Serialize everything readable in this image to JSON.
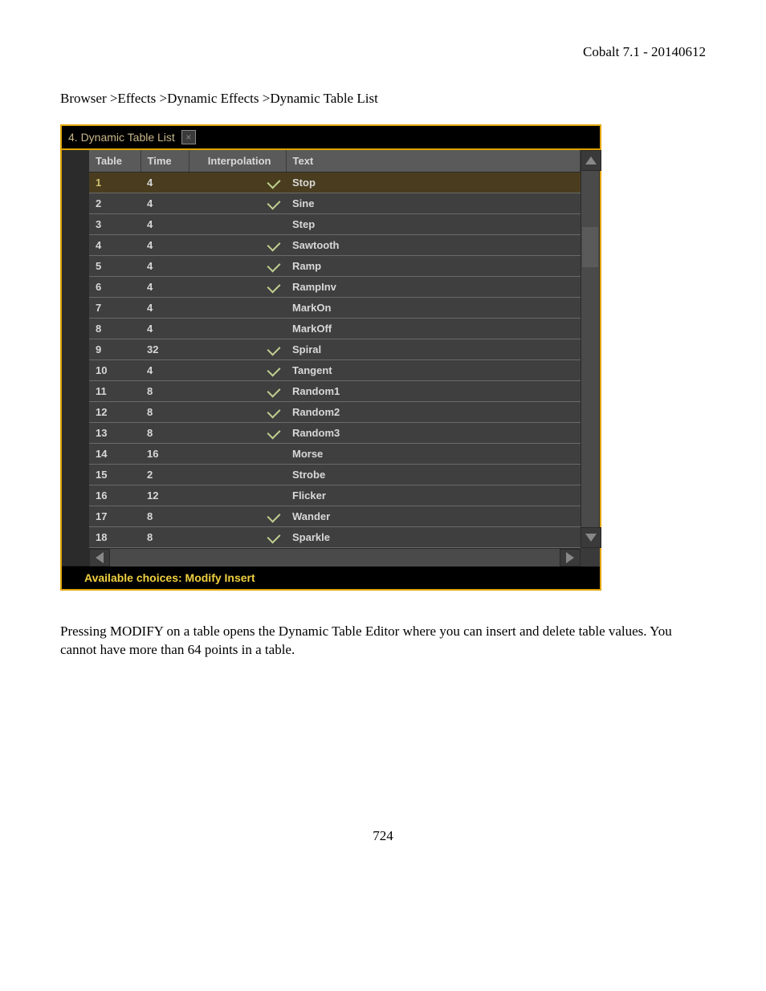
{
  "header": {
    "product_version": "Cobalt 7.1 - 20140612"
  },
  "breadcrumb": "Browser >Effects >Dynamic Effects >Dynamic Table List",
  "panel": {
    "title": "4. Dynamic Table List",
    "columns": {
      "table": "Table",
      "time": "Time",
      "interpolation": "Interpolation",
      "text": "Text"
    },
    "rows": [
      {
        "table": "1",
        "time": "4",
        "interp": true,
        "text": "Stop",
        "selected": true
      },
      {
        "table": "2",
        "time": "4",
        "interp": true,
        "text": "Sine",
        "selected": false
      },
      {
        "table": "3",
        "time": "4",
        "interp": false,
        "text": "Step",
        "selected": false
      },
      {
        "table": "4",
        "time": "4",
        "interp": true,
        "text": "Sawtooth",
        "selected": false
      },
      {
        "table": "5",
        "time": "4",
        "interp": true,
        "text": "Ramp",
        "selected": false
      },
      {
        "table": "6",
        "time": "4",
        "interp": true,
        "text": "RampInv",
        "selected": false
      },
      {
        "table": "7",
        "time": "4",
        "interp": false,
        "text": "MarkOn",
        "selected": false
      },
      {
        "table": "8",
        "time": "4",
        "interp": false,
        "text": "MarkOff",
        "selected": false
      },
      {
        "table": "9",
        "time": "32",
        "interp": true,
        "text": "Spiral",
        "selected": false
      },
      {
        "table": "10",
        "time": "4",
        "interp": true,
        "text": "Tangent",
        "selected": false
      },
      {
        "table": "11",
        "time": "8",
        "interp": true,
        "text": "Random1",
        "selected": false
      },
      {
        "table": "12",
        "time": "8",
        "interp": true,
        "text": "Random2",
        "selected": false
      },
      {
        "table": "13",
        "time": "8",
        "interp": true,
        "text": "Random3",
        "selected": false
      },
      {
        "table": "14",
        "time": "16",
        "interp": false,
        "text": "Morse",
        "selected": false
      },
      {
        "table": "15",
        "time": "2",
        "interp": false,
        "text": "Strobe",
        "selected": false
      },
      {
        "table": "16",
        "time": "12",
        "interp": false,
        "text": "Flicker",
        "selected": false
      },
      {
        "table": "17",
        "time": "8",
        "interp": true,
        "text": "Wander",
        "selected": false
      },
      {
        "table": "18",
        "time": "8",
        "interp": true,
        "text": "Sparkle",
        "selected": false
      }
    ],
    "footer": "Available choices: Modify Insert"
  },
  "body_text": "Pressing MODIFY on a table opens the Dynamic Table Editor where you can insert and delete table values. You cannot have more than 64 points in a table.",
  "page_number": "724"
}
